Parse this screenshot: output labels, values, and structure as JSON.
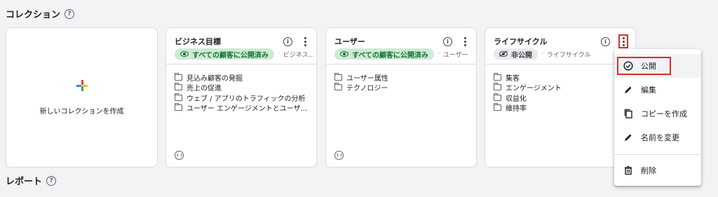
{
  "sections": {
    "collections_title": "コレクション",
    "reports_title": "レポート"
  },
  "new_collection": {
    "label": "新しいコレクションを作成"
  },
  "cards": [
    {
      "title": "ビジネス目標",
      "badge": "すべての顧客に公開済み",
      "badge_status": "published",
      "extra": "ビジネス...",
      "items": [
        "見込み顧客の発掘",
        "売上の促進",
        "ウェブ / アプリのトラフィックの分析",
        "ユーザー エンゲージメントとユーザ..."
      ],
      "library_icon": "library-icon"
    },
    {
      "title": "ユーザー",
      "badge": "すべての顧客に公開済み",
      "badge_status": "published",
      "extra": "ユーザー",
      "items": [
        "ユーザー属性",
        "テクノロジー"
      ],
      "library_icon": "library-icon"
    },
    {
      "title": "ライフサイクル",
      "badge": "非公開",
      "badge_status": "unpublished",
      "extra": "ライフサイクル",
      "items": [
        "集客",
        "エンゲージメント",
        "収益化",
        "維持率"
      ]
    }
  ],
  "menu": {
    "items": [
      {
        "label": "公開",
        "icon": "check-circle-icon"
      },
      {
        "label": "編集",
        "icon": "pencil-icon"
      },
      {
        "label": "コピーを作成",
        "icon": "copy-icon"
      },
      {
        "label": "名前を変更",
        "icon": "pencil-icon"
      },
      {
        "label": "削除",
        "icon": "trash-icon"
      }
    ]
  },
  "colors": {
    "published_bg": "#ceead6",
    "published_text": "#137333",
    "highlight_border": "#d93025",
    "plus_blue": "#4285f4",
    "plus_red": "#ea4335",
    "plus_yellow": "#fbbc04",
    "plus_green": "#34a853"
  }
}
